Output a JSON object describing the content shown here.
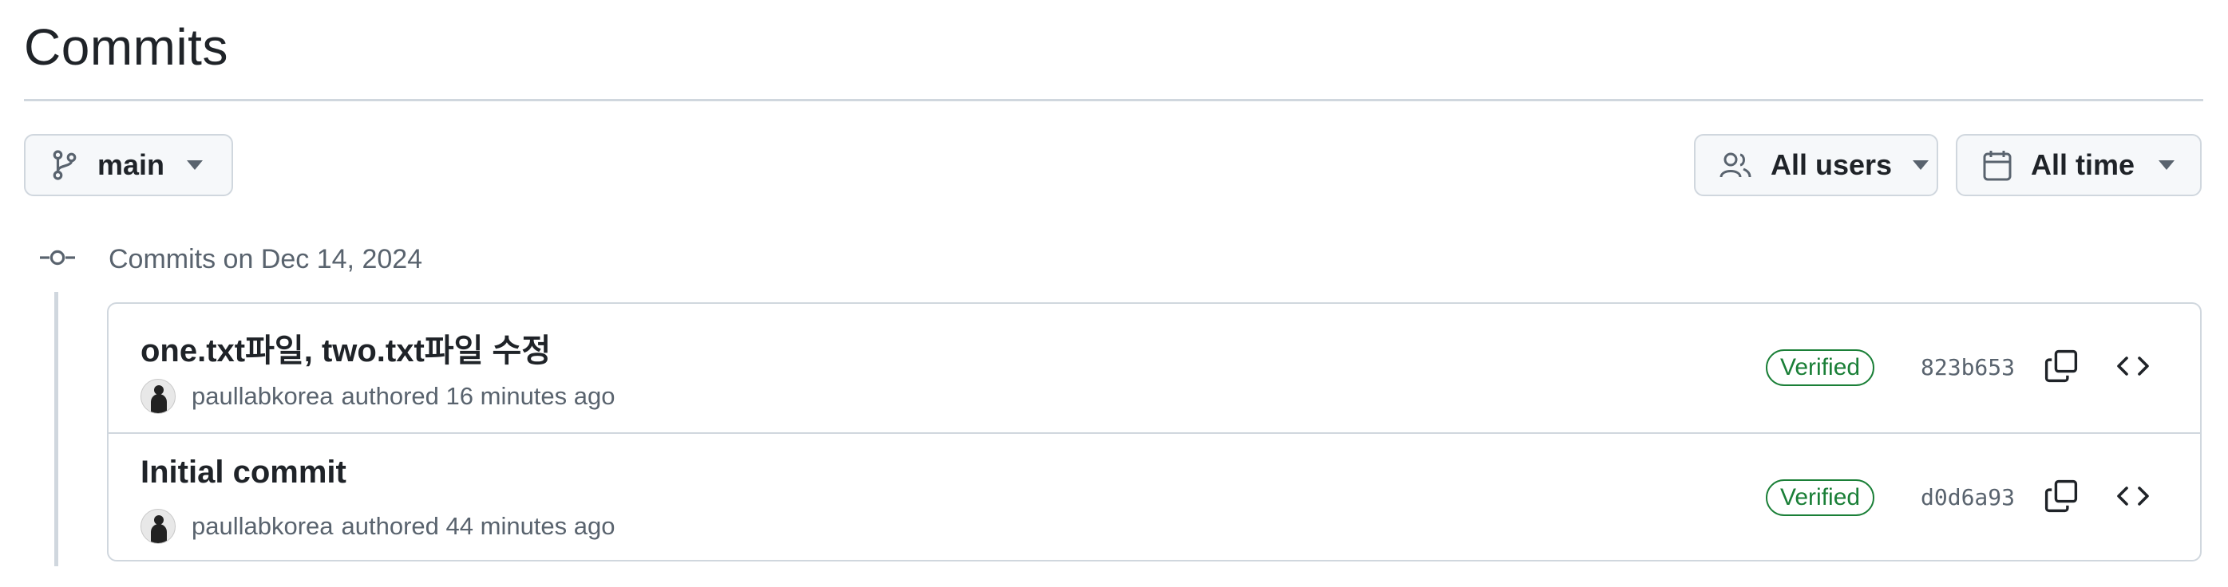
{
  "page": {
    "title": "Commits"
  },
  "filters": {
    "branch": "main",
    "users": "All users",
    "time": "All time"
  },
  "group": {
    "label": "Commits on Dec 14, 2024"
  },
  "commits": [
    {
      "message": "one.txt파일, two.txt파일 수정",
      "author": "paullabkorea",
      "meta": "authored 16 minutes ago",
      "badge": "Verified",
      "sha": "823b653"
    },
    {
      "message": "Initial commit",
      "author": "paullabkorea",
      "meta": "authored 44 minutes ago",
      "badge": "Verified",
      "sha": "d0d6a93"
    }
  ],
  "colors": {
    "text": "#1f2328",
    "muted": "#59636e",
    "border": "#d0d7de",
    "button_bg": "#f6f8fa",
    "verified": "#1a7f37"
  },
  "icons": {
    "branch": "git-branch-icon",
    "users": "people-icon",
    "calendar": "calendar-icon",
    "caret": "triangle-down-icon",
    "commit": "git-commit-icon",
    "copy": "copy-icon",
    "code": "code-icon"
  }
}
